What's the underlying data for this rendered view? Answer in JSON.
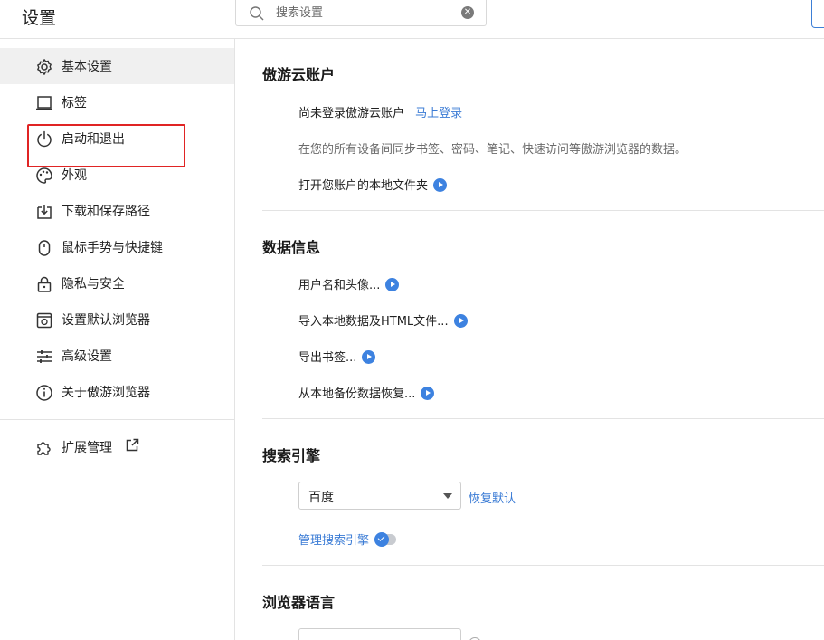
{
  "header": {
    "title": "设置",
    "search_placeholder": "搜索设置"
  },
  "sidebar": {
    "items": [
      {
        "label": "基本设置",
        "icon": "gear-icon",
        "active": true
      },
      {
        "label": "标签",
        "icon": "tab-icon"
      },
      {
        "label": "启动和退出",
        "icon": "power-icon"
      },
      {
        "label": "外观",
        "icon": "palette-icon"
      },
      {
        "label": "下载和保存路径",
        "icon": "download-icon"
      },
      {
        "label": "鼠标手势与快捷键",
        "icon": "mouse-icon"
      },
      {
        "label": "隐私与安全",
        "icon": "lock-icon"
      },
      {
        "label": "设置默认浏览器",
        "icon": "browser-icon"
      },
      {
        "label": "高级设置",
        "icon": "sliders-icon"
      },
      {
        "label": "关于傲游浏览器",
        "icon": "info-icon"
      }
    ],
    "extensions": {
      "label": "扩展管理",
      "icon": "puzzle-icon",
      "link_icon": "external-link-icon"
    }
  },
  "account": {
    "title": "傲游云账户",
    "status": "尚未登录傲游云账户",
    "login_link": "马上登录",
    "description": "在您的所有设备间同步书签、密码、笔记、快速访问等傲游浏览器的数据。",
    "open_folder": "打开您账户的本地文件夹"
  },
  "data_info": {
    "title": "数据信息",
    "items": [
      "用户名和头像...",
      "导入本地数据及HTML文件...",
      "导出书签...",
      "从本地备份数据恢复..."
    ]
  },
  "search_engine": {
    "title": "搜索引擎",
    "selected": "百度",
    "restore_default": "恢复默认",
    "manage": "管理搜索引擎"
  },
  "language": {
    "title": "浏览器语言"
  },
  "colors": {
    "accent": "#3d82e0",
    "link": "#3a7bd5",
    "highlight": "#e02424"
  }
}
